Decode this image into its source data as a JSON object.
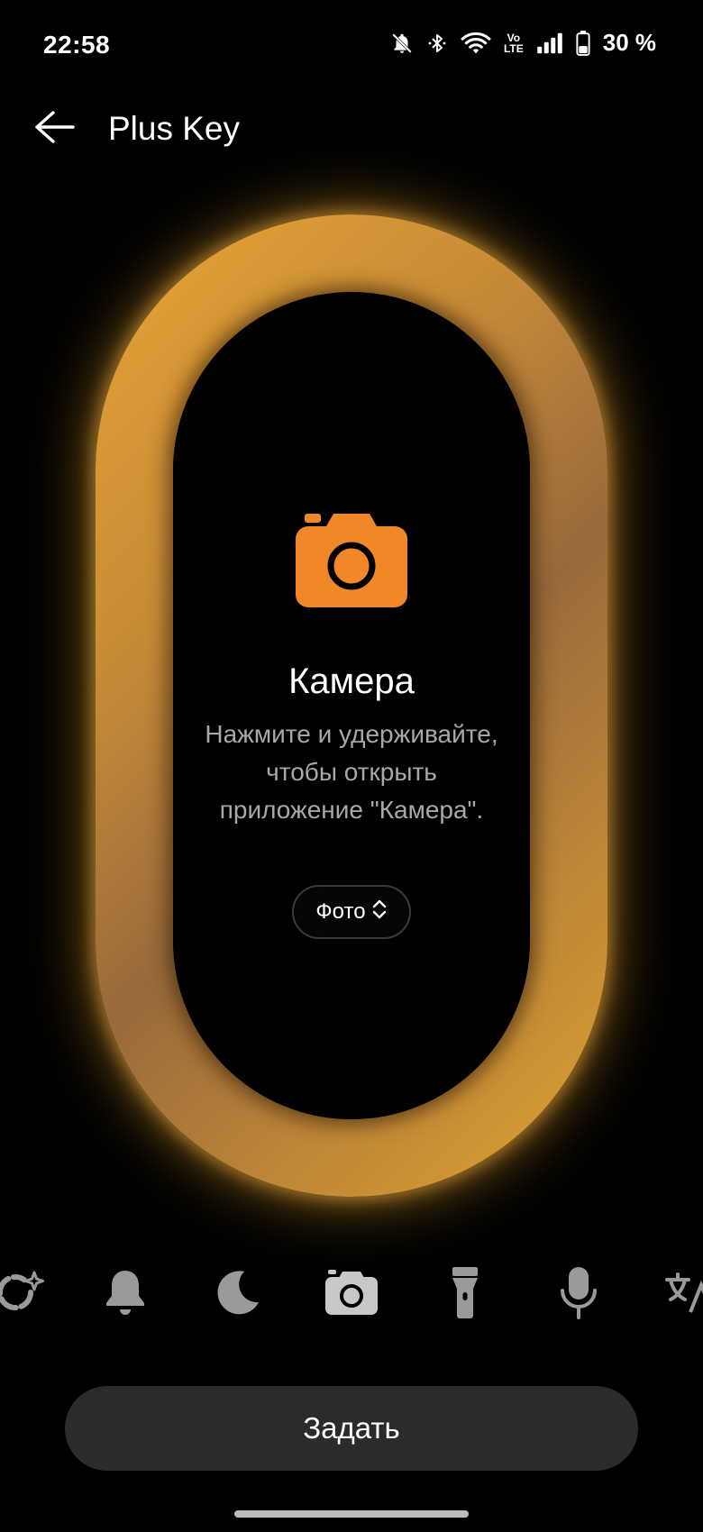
{
  "status_bar": {
    "time": "22:58",
    "battery_percent": "30 %",
    "icons": [
      "bell-off-icon",
      "bluetooth-icon",
      "wifi-icon",
      "volte-icon",
      "signal-icon",
      "battery-icon"
    ],
    "volte_top": "Vo",
    "volte_bottom": "LTE"
  },
  "header": {
    "title": "Plus Key",
    "back_icon": "arrow-left-icon"
  },
  "feature": {
    "icon": "camera-icon",
    "title": "Камера",
    "description": "Нажмите и удерживайте, чтобы открыть приложение \"Камера\".",
    "mode_value": "Фото",
    "mode_icon": "chevron-up-down-icon"
  },
  "colors": {
    "accent": "#F0882A",
    "ring": "#D69A34",
    "button_bg": "#2B2B2B",
    "shortcut_icon": "#9A9A9A",
    "selected_shortcut_icon": "#C8C8C8"
  },
  "shortcuts": [
    {
      "name": "ai-sparkle-icon",
      "selected": false
    },
    {
      "name": "bell-icon",
      "selected": false
    },
    {
      "name": "moon-icon",
      "selected": false
    },
    {
      "name": "camera-icon",
      "selected": true
    },
    {
      "name": "flashlight-icon",
      "selected": false
    },
    {
      "name": "microphone-icon",
      "selected": false
    },
    {
      "name": "translate-icon",
      "selected": false
    }
  ],
  "action": {
    "set_label": "Задать"
  }
}
